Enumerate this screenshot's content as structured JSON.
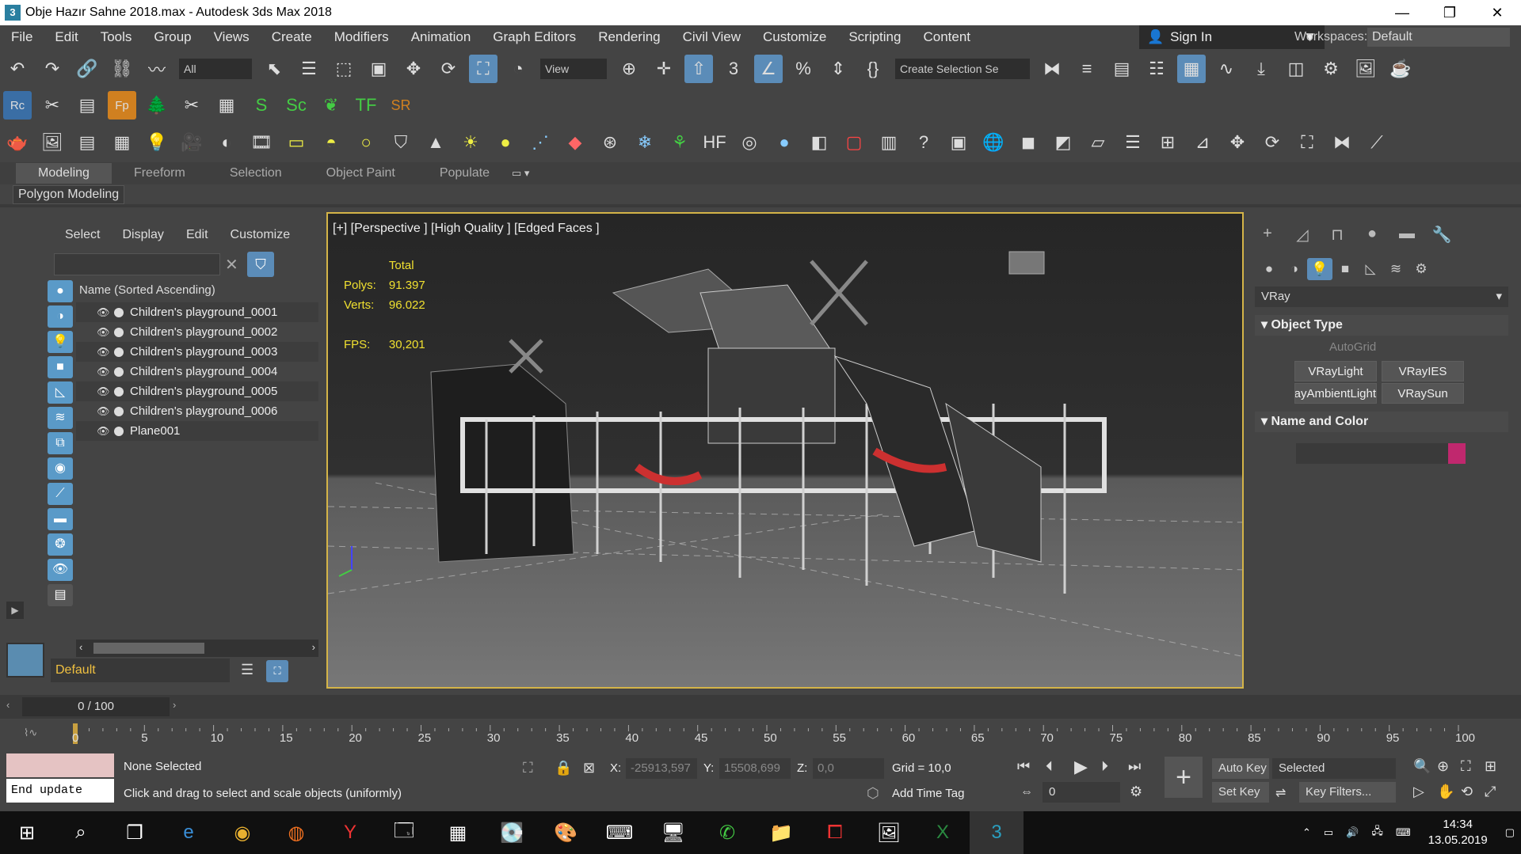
{
  "window": {
    "title": "Obje Hazır Sahne 2018.max - Autodesk 3ds Max 2018",
    "app_icon": "3",
    "minimize": "—",
    "restore": "❐",
    "close": "✕"
  },
  "menu": [
    "File",
    "Edit",
    "Tools",
    "Group",
    "Views",
    "Create",
    "Modifiers",
    "Animation",
    "Graph Editors",
    "Rendering",
    "Civil View",
    "Customize",
    "Scripting",
    "Content"
  ],
  "sign_in": "Sign In",
  "workspaces_label": "Workspaces:",
  "workspace_value": "Default",
  "toolbar": {
    "filter_value": "All",
    "ref_coord_value": "View",
    "selection_set_placeholder": "Create Selection Se"
  },
  "ribbon": {
    "tabs": [
      "Modeling",
      "Freeform",
      "Selection",
      "Object Paint",
      "Populate"
    ],
    "panel": "Polygon Modeling"
  },
  "explorer": {
    "menu": [
      "Select",
      "Display",
      "Edit",
      "Customize"
    ],
    "column_header": "Name (Sorted Ascending)",
    "items": [
      "Children's playground_0001",
      "Children's playground_0002",
      "Children's playground_0003",
      "Children's playground_0004",
      "Children's playground_0005",
      "Children's playground_0006",
      "Plane001"
    ],
    "layer": "Default"
  },
  "viewport": {
    "label": "[+] [Perspective ] [High Quality ] [Edged Faces ]",
    "stats_header": "Total",
    "polys_label": "Polys:",
    "polys": "91.397",
    "verts_label": "Verts:",
    "verts": "96.022",
    "fps_label": "FPS:",
    "fps": "30,201"
  },
  "command_panel": {
    "renderer": "VRay",
    "object_type": "Object Type",
    "autogrid": "AutoGrid",
    "buttons": [
      "VRayLight",
      "VRayIES",
      "VRayAmbientLight",
      "VRaySun"
    ],
    "name_color": "Name and Color",
    "swatch_color": "#c0286e"
  },
  "time_slider": "0 / 100",
  "trackbar_ticks": [
    "0",
    "5",
    "10",
    "15",
    "20",
    "25",
    "30",
    "35",
    "40",
    "45",
    "50",
    "55",
    "60",
    "65",
    "70",
    "75",
    "80",
    "85",
    "90",
    "95",
    "100"
  ],
  "status": {
    "selection": "None Selected",
    "prompt": "Click and drag to select and scale objects (uniformly)",
    "maxscript": "End update",
    "x_label": "X:",
    "x": "-25913,597",
    "y_label": "Y:",
    "y": "15508,699",
    "z_label": "Z:",
    "z": "0,0",
    "grid": "Grid = 10,0",
    "add_time_tag": "Add Time Tag",
    "auto_key": "Auto Key",
    "set_key": "Set Key",
    "selected": "Selected",
    "key_filters": "Key Filters...",
    "frame": "0"
  },
  "clock": {
    "time": "14:34",
    "date": "13.05.2019"
  },
  "accent": "#5b8cb8",
  "viewport_border": "#d4b448"
}
